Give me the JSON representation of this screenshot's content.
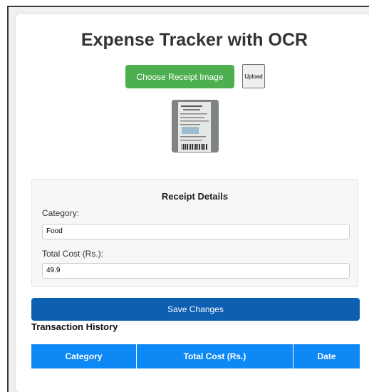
{
  "app": {
    "title": "Expense Tracker with OCR"
  },
  "upload": {
    "choose_label": "Choose Receipt Image",
    "upload_label": "Upload"
  },
  "receipt_details": {
    "title": "Receipt Details",
    "category_label": "Category:",
    "category_value": "Food",
    "total_label": "Total Cost (Rs.):",
    "total_value": "49.9"
  },
  "actions": {
    "save_label": "Save Changes"
  },
  "history": {
    "title": "Transaction History",
    "columns": [
      "Category",
      "Total Cost (Rs.)",
      "Date"
    ]
  },
  "colors": {
    "choose_button": "#4caf50",
    "save_button": "#0d5fb1",
    "table_header": "#0d88f5"
  }
}
